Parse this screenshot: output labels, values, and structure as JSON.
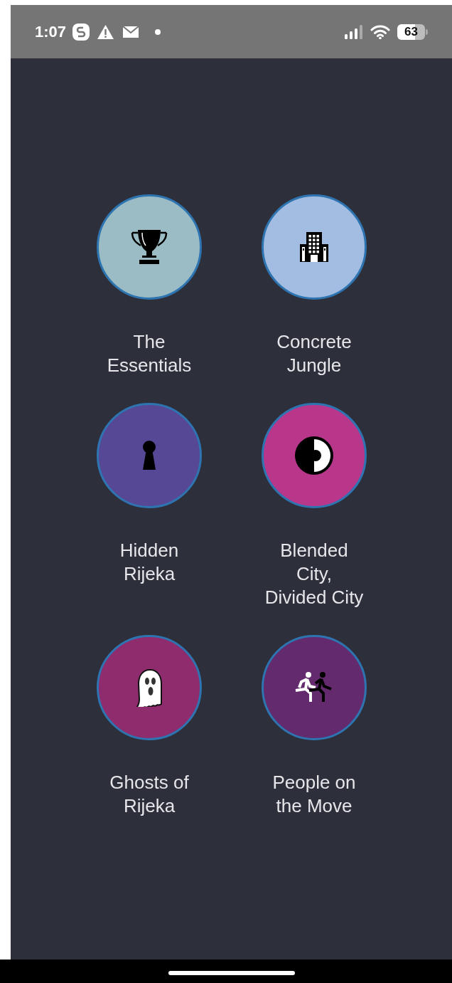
{
  "status_bar": {
    "time": "1:07",
    "battery": "63"
  },
  "categories": [
    {
      "label": "The Essentials",
      "color": "#9bbcc4"
    },
    {
      "label": "Concrete Jungle",
      "color": "#a3bce2"
    },
    {
      "label": "Hidden Rijeka",
      "color": "#574896"
    },
    {
      "label": "Blended City, Divided City",
      "color": "#b9378b"
    },
    {
      "label": "Ghosts of Rijeka",
      "color": "#8e2c6e"
    },
    {
      "label": "People on the Move",
      "color": "#632b6e"
    }
  ]
}
